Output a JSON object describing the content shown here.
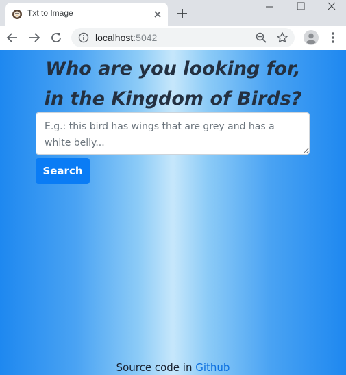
{
  "tab": {
    "title": "Txt to Image",
    "favicon": "bird-favicon-icon",
    "close_icon": "close-icon"
  },
  "window_controls": [
    "minimize-icon",
    "maximize-icon",
    "close-icon"
  ],
  "toolbar": {
    "url_host": "localhost",
    "url_port": ":5042",
    "icons": [
      "back-arrow-icon",
      "forward-arrow-icon",
      "reload-icon",
      "info-icon",
      "zoom-icon",
      "star-icon",
      "profile-icon",
      "menu-icon"
    ]
  },
  "page": {
    "heading_line1": "Who are you looking for,",
    "heading_line2": "in the Kingdom of Birds?",
    "query_placeholder": "E.g.: this bird has wings that are grey and has a white belly...",
    "query_value": "",
    "search_label": "Search",
    "footer_prefix": "Source code in ",
    "footer_link": "Github"
  },
  "colors": {
    "gradient_edge": "#1e88f0",
    "gradient_center": "#c6e7fb",
    "button": "#0a7cf5",
    "heading": "#243040",
    "link": "#0b6fe0"
  }
}
